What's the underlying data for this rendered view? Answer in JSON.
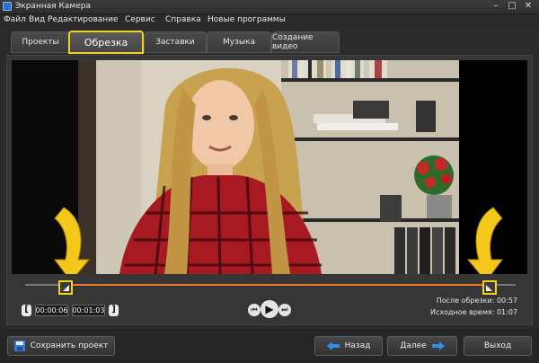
{
  "window": {
    "title": "Экранная Камера"
  },
  "menu": [
    "Файл",
    "Вид",
    "Редактирование",
    "Сервис",
    "Справка",
    "Новые программы"
  ],
  "tabs": [
    {
      "label": "Проекты",
      "active": false
    },
    {
      "label": "Обрезка",
      "active": true
    },
    {
      "label": "Заставки",
      "active": false
    },
    {
      "label": "Музыка",
      "active": false
    },
    {
      "label": "Создание видео",
      "active": false
    }
  ],
  "trim": {
    "start_time": "00:00:06",
    "end_time": "00:01:03"
  },
  "info": {
    "after_label": "После обрезки:",
    "after_value": "00:57",
    "source_label": "Исходное время:",
    "source_value": "01:07"
  },
  "buttons": {
    "save": "Сохранить проект",
    "back": "Назад",
    "next": "Далее",
    "exit": "Выход"
  },
  "colors": {
    "highlight": "#f2d21a",
    "timeline_fill": "#f07a2a",
    "arrow_blue": "#2f8fe8"
  }
}
